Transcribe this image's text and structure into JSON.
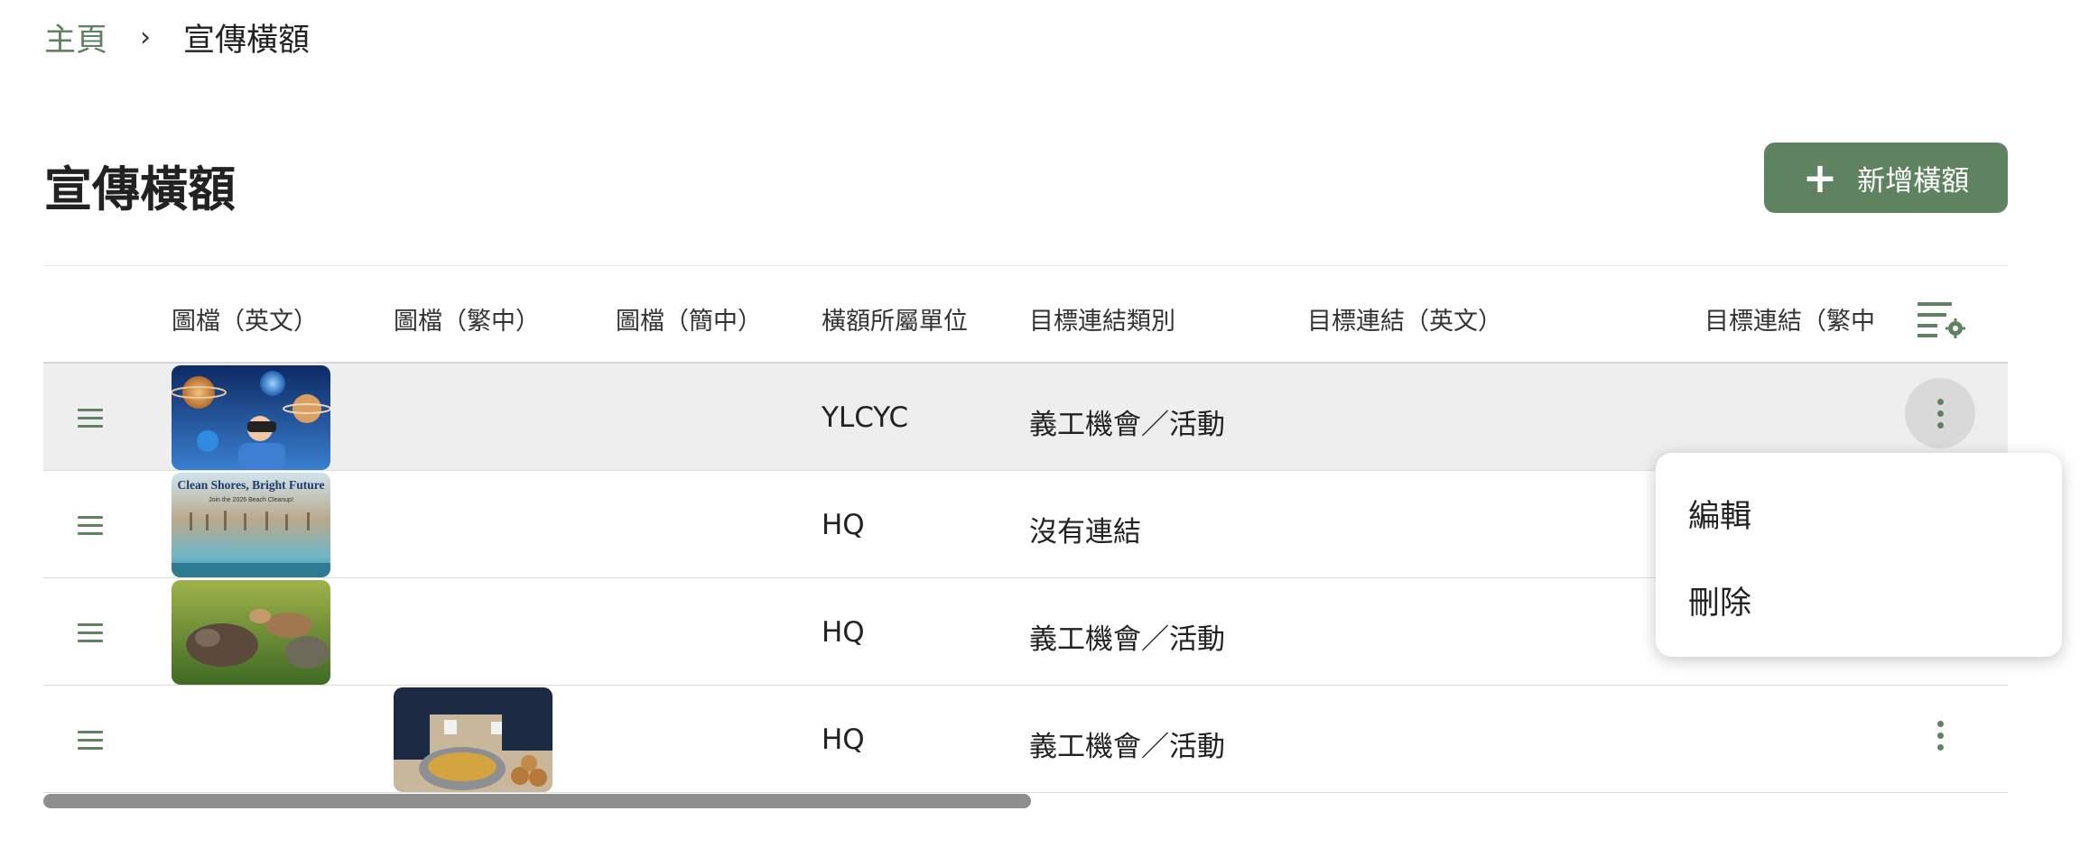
{
  "breadcrumb": {
    "home": "主頁",
    "separator": "›",
    "current": "宣傳橫額"
  },
  "page": {
    "title": "宣傳橫額",
    "add_button": "新增橫額"
  },
  "table": {
    "columns": [
      "圖檔（英文）",
      "圖檔（繁中）",
      "圖檔（簡中）",
      "橫額所屬單位",
      "目標連結類別",
      "目標連結（英文）",
      "目標連結（繁中"
    ],
    "rows": [
      {
        "image_en": "space-vr-banner",
        "image_tc": "",
        "image_sc": "",
        "unit": "YLCYC",
        "link_type": "義工機會／活動",
        "link_en": "",
        "link_tc": ""
      },
      {
        "image_en": "beach-cleanup-banner",
        "image_tc": "",
        "image_sc": "",
        "unit": "HQ",
        "link_type": "沒有連結",
        "link_en": "",
        "link_tc": ""
      },
      {
        "image_en": "animals-grass-banner",
        "image_tc": "",
        "image_sc": "",
        "unit": "HQ",
        "link_type": "義工機會／活動",
        "link_en": "",
        "link_tc": ""
      },
      {
        "image_en": "",
        "image_tc": "volunteer-food-banner",
        "image_sc": "",
        "unit": "HQ",
        "link_type": "義工機會／活動",
        "link_en": "",
        "link_tc": ""
      }
    ],
    "thumb_texts": {
      "beach_title": "Clean Shores, Bright Future",
      "beach_sub": "Join the 2026 Beach Cleanup!"
    }
  },
  "menu": {
    "edit": "編輯",
    "delete": "刪除"
  },
  "icons": {
    "drag": "drag-handle-icon",
    "settings": "column-settings-icon",
    "more": "more-vert-icon",
    "add": "plus-icon"
  },
  "colors": {
    "accent": "#5f8360",
    "row_highlight": "#eeeeee"
  }
}
